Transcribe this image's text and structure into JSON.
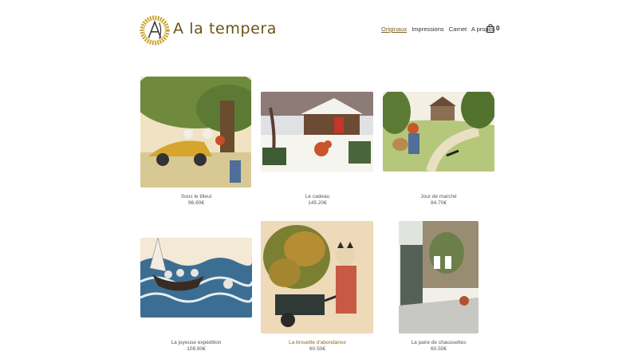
{
  "site": {
    "title": "A la tempera"
  },
  "nav": {
    "items": [
      "Originaux",
      "Impressions",
      "Carnet",
      "A propos"
    ],
    "cart_count": "0"
  },
  "products": [
    {
      "name": "Sous le tilleul",
      "price": "96.80€"
    },
    {
      "name": "Le cadeau",
      "price": "145.20€"
    },
    {
      "name": "Jour de marché",
      "price": "84.70€"
    },
    {
      "name": "La joyeuse expédition",
      "price": "108.90€"
    },
    {
      "name": "La brouette d'abondance",
      "price": "60.50€"
    },
    {
      "name": "La paire de chaussettes",
      "price": "60.50€"
    }
  ],
  "colors": {
    "accent": "#7a5e1e",
    "title": "#6b5316"
  }
}
